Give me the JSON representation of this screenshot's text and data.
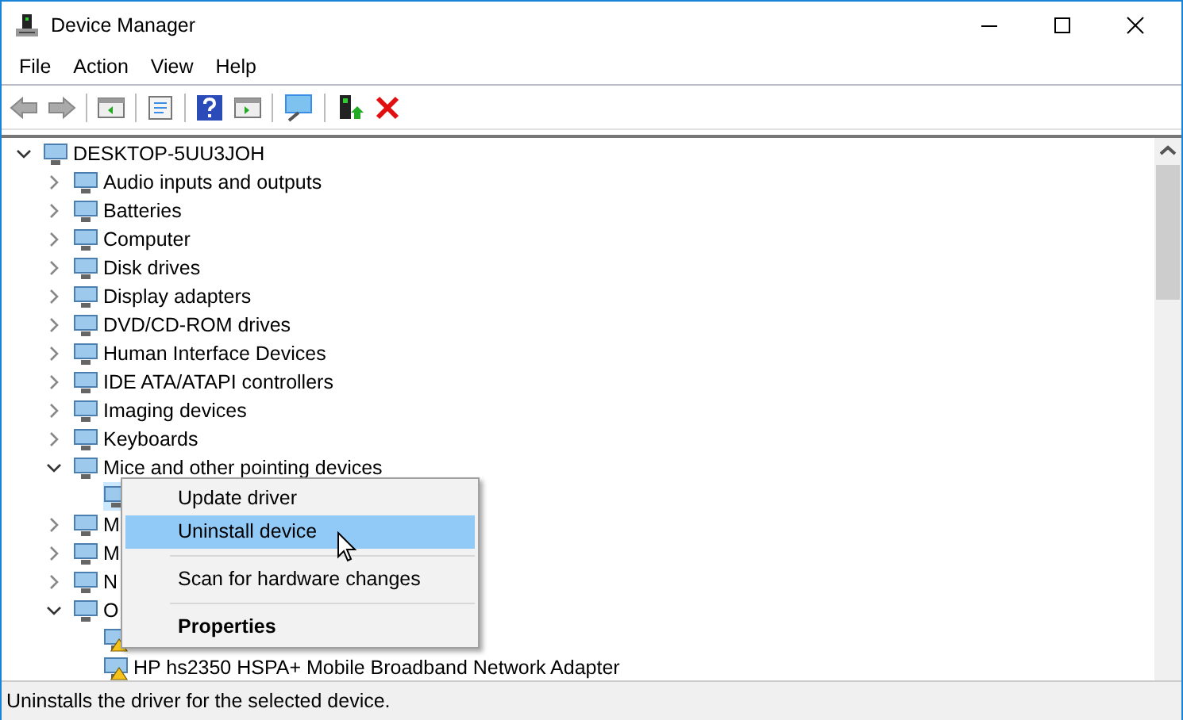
{
  "window": {
    "title": "Device Manager"
  },
  "menu_bar": [
    "File",
    "Action",
    "View",
    "Help"
  ],
  "tree": {
    "label": "DESKTOP-5UU3JOH",
    "expanded": true,
    "selected": false,
    "children": [
      {
        "label": "Audio inputs and outputs",
        "expanded": false,
        "selected": false
      },
      {
        "label": "Batteries",
        "expanded": false,
        "selected": false
      },
      {
        "label": "Computer",
        "expanded": false,
        "selected": false
      },
      {
        "label": "Disk drives",
        "expanded": false,
        "selected": false
      },
      {
        "label": "Display adapters",
        "expanded": false,
        "selected": false
      },
      {
        "label": "DVD/CD-ROM drives",
        "expanded": false,
        "selected": false
      },
      {
        "label": "Human Interface Devices",
        "expanded": false,
        "selected": false
      },
      {
        "label": "IDE ATA/ATAPI controllers",
        "expanded": false,
        "selected": false
      },
      {
        "label": "Imaging devices",
        "expanded": false,
        "selected": false
      },
      {
        "label": "Keyboards",
        "expanded": false,
        "selected": false
      },
      {
        "label": "Mice and other pointing devices",
        "expanded": true,
        "selected": false,
        "children": [
          {
            "selected": true
          }
        ]
      },
      {
        "label": "M",
        "expanded": false,
        "selected": false
      },
      {
        "label": "M",
        "expanded": false,
        "selected": false
      },
      {
        "label": "N",
        "expanded": false,
        "selected": false
      },
      {
        "label": "O",
        "expanded": true,
        "selected": false,
        "children": [
          {
            "selected": false,
            "warning": true
          },
          {
            "label": "HP hs2350 HSPA+ Mobile Broadband Network Adapter",
            "selected": false,
            "warning": true
          }
        ]
      }
    ]
  },
  "context_menu": [
    {
      "kind": "item",
      "label": "Update driver",
      "highlighted": false,
      "bold": false
    },
    {
      "kind": "item",
      "label": "Uninstall device",
      "highlighted": true,
      "bold": false
    },
    {
      "kind": "separator"
    },
    {
      "kind": "item",
      "label": "Scan for hardware changes",
      "highlighted": false,
      "bold": false
    },
    {
      "kind": "separator"
    },
    {
      "kind": "item",
      "label": "Properties",
      "highlighted": false,
      "bold": true
    }
  ],
  "status_bar": "Uninstalls the driver for the selected device."
}
